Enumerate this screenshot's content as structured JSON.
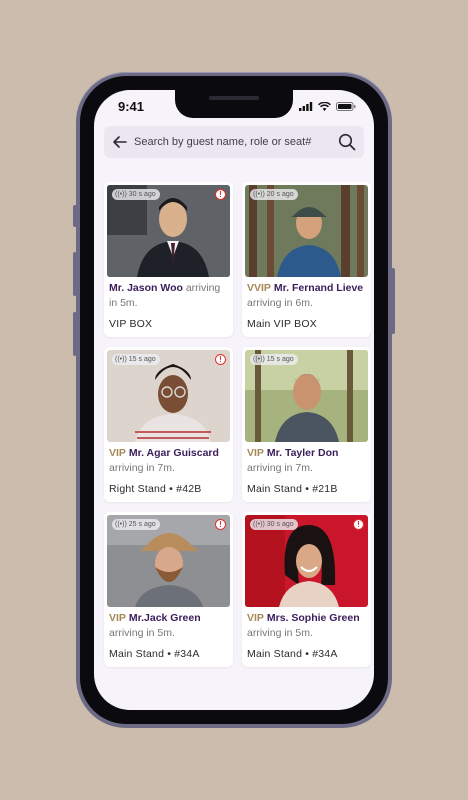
{
  "status_bar": {
    "time": "9:41"
  },
  "search": {
    "placeholder": "Search by guest name, role or seat#"
  },
  "colors": {
    "accent": "#3b1d5a",
    "vip_gold": "#a48856",
    "alert": "#d33333"
  },
  "guests": [
    {
      "ago": "30 s ago",
      "tag": "",
      "name": "Mr. Jason Woo",
      "arrival": " arriving in 5m.",
      "seat": "VIP BOX"
    },
    {
      "ago": "20 s ago",
      "tag": "VVIP",
      "name": "Mr. Fernand Lieve",
      "arrival": " arriving in 6m.",
      "seat": "Main VIP BOX"
    },
    {
      "ago": "15 s ago",
      "tag": "VIP",
      "name": "Mr. Agar Guiscard",
      "arrival": " arriving in 7m.",
      "seat": "Right Stand • #42B"
    },
    {
      "ago": "15 s ago",
      "tag": "VIP",
      "name": "Mr. Tayler Don",
      "arrival": " arriving in 7m.",
      "seat": "Main Stand • #21B"
    },
    {
      "ago": "25 s ago",
      "tag": "VIP",
      "name": "Mr.Jack Green",
      "arrival": " arriving in 5m.",
      "seat": "Main Stand • #34A"
    },
    {
      "ago": "30 s ago",
      "tag": "VIP",
      "name": "Mrs. Sophie Green",
      "arrival": " arriving in 5m.",
      "seat": "Main Stand • #34A"
    }
  ]
}
